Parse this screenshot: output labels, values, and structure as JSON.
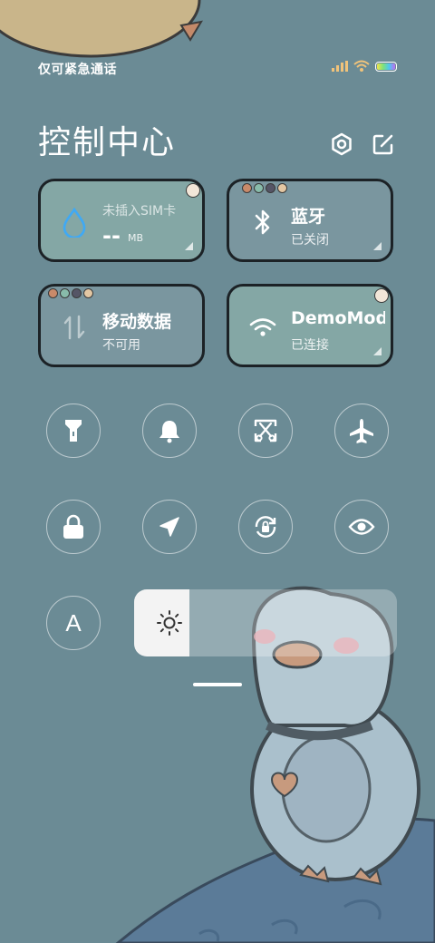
{
  "status_bar": {
    "carrier_text": "仅可紧急通话",
    "signal_icon": "signal-bars-icon",
    "wifi_icon": "wifi-icon",
    "battery_icon": "battery-icon"
  },
  "header": {
    "title": "控制中心",
    "settings_icon": "gear-icon",
    "edit_icon": "edit-icon"
  },
  "tiles": [
    {
      "id": "data-usage",
      "title": "未插入SIM卡",
      "value": "--",
      "unit": "MB",
      "icon": "water-drop-icon"
    },
    {
      "id": "bluetooth",
      "title": "蓝牙",
      "subtitle": "已关闭",
      "icon": "bluetooth-icon"
    },
    {
      "id": "mobile-data",
      "title": "移动数据",
      "subtitle": "不可用",
      "icon": "data-arrows-icon"
    },
    {
      "id": "wifi",
      "title": "DemoMod",
      "subtitle": "已连接",
      "icon": "wifi-icon"
    }
  ],
  "toggles_row1": [
    "flashlight-icon",
    "bell-icon",
    "screenshot-icon",
    "airplane-icon"
  ],
  "toggles_row2": [
    "lock-icon",
    "location-icon",
    "rotation-lock-icon",
    "eye-icon"
  ],
  "auto_brightness": {
    "label": "A"
  },
  "brightness": {
    "icon": "sun-icon",
    "level": 0.21
  },
  "colors": {
    "background": "#6b8b95",
    "tile_active": "#84a7a5",
    "accent_blue": "#3fa9f5"
  }
}
